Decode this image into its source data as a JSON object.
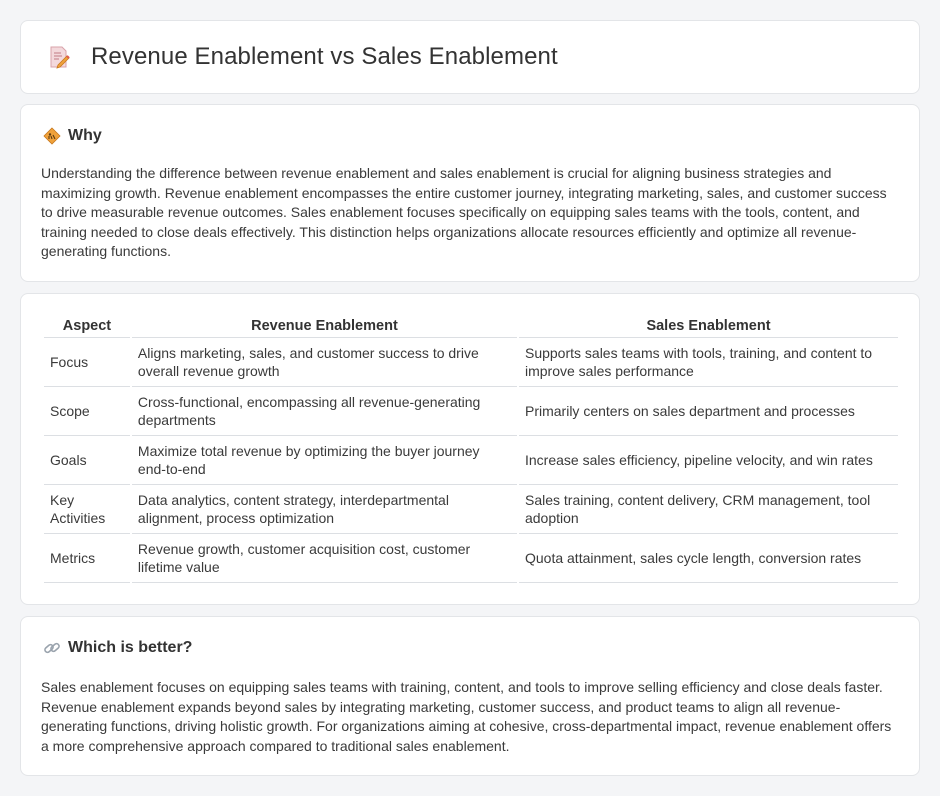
{
  "header": {
    "title": "Revenue Enablement vs Sales Enablement",
    "icon": "document-pencil-icon"
  },
  "why": {
    "title": "Why",
    "icon": "diamond-sign-icon",
    "text": "Understanding the difference between revenue enablement and sales enablement is crucial for aligning business strategies and maximizing growth. Revenue enablement encompasses the entire customer journey, integrating marketing, sales, and customer success to drive measurable revenue outcomes. Sales enablement focuses specifically on equipping sales teams with the tools, content, and training needed to close deals effectively. This distinction helps organizations allocate resources efficiently and optimize all revenue-generating functions."
  },
  "table": {
    "headers": [
      "Aspect",
      "Revenue Enablement",
      "Sales Enablement"
    ],
    "rows": [
      [
        "Focus",
        "Aligns marketing, sales, and customer success to drive overall revenue growth",
        "Supports sales teams with tools, training, and content to improve sales performance"
      ],
      [
        "Scope",
        "Cross-functional, encompassing all revenue-generating departments",
        "Primarily centers on sales department and processes"
      ],
      [
        "Goals",
        "Maximize total revenue by optimizing the buyer journey end-to-end",
        "Increase sales efficiency, pipeline velocity, and win rates"
      ],
      [
        "Key Activities",
        "Data analytics, content strategy, interdepartmental alignment, process optimization",
        "Sales training, content delivery, CRM management, tool adoption"
      ],
      [
        "Metrics",
        "Revenue growth, customer acquisition cost, customer lifetime value",
        "Quota attainment, sales cycle length, conversion rates"
      ]
    ]
  },
  "better": {
    "title": "Which is better?",
    "icon": "link-icon",
    "text": "Sales enablement focuses on equipping sales teams with training, content, and tools to improve selling efficiency and close deals faster. Revenue enablement expands beyond sales by integrating marketing, customer success, and product teams to align all revenue-generating functions, driving holistic growth. For organizations aiming at cohesive, cross-departmental impact, revenue enablement offers a more comprehensive approach compared to traditional sales enablement."
  },
  "colors": {
    "background": "#f4f5f7",
    "card": "#ffffff",
    "border": "#e3e5e8",
    "text": "#333333",
    "icon_orange": "#f0a23b",
    "icon_pink": "#e9b3b8"
  }
}
